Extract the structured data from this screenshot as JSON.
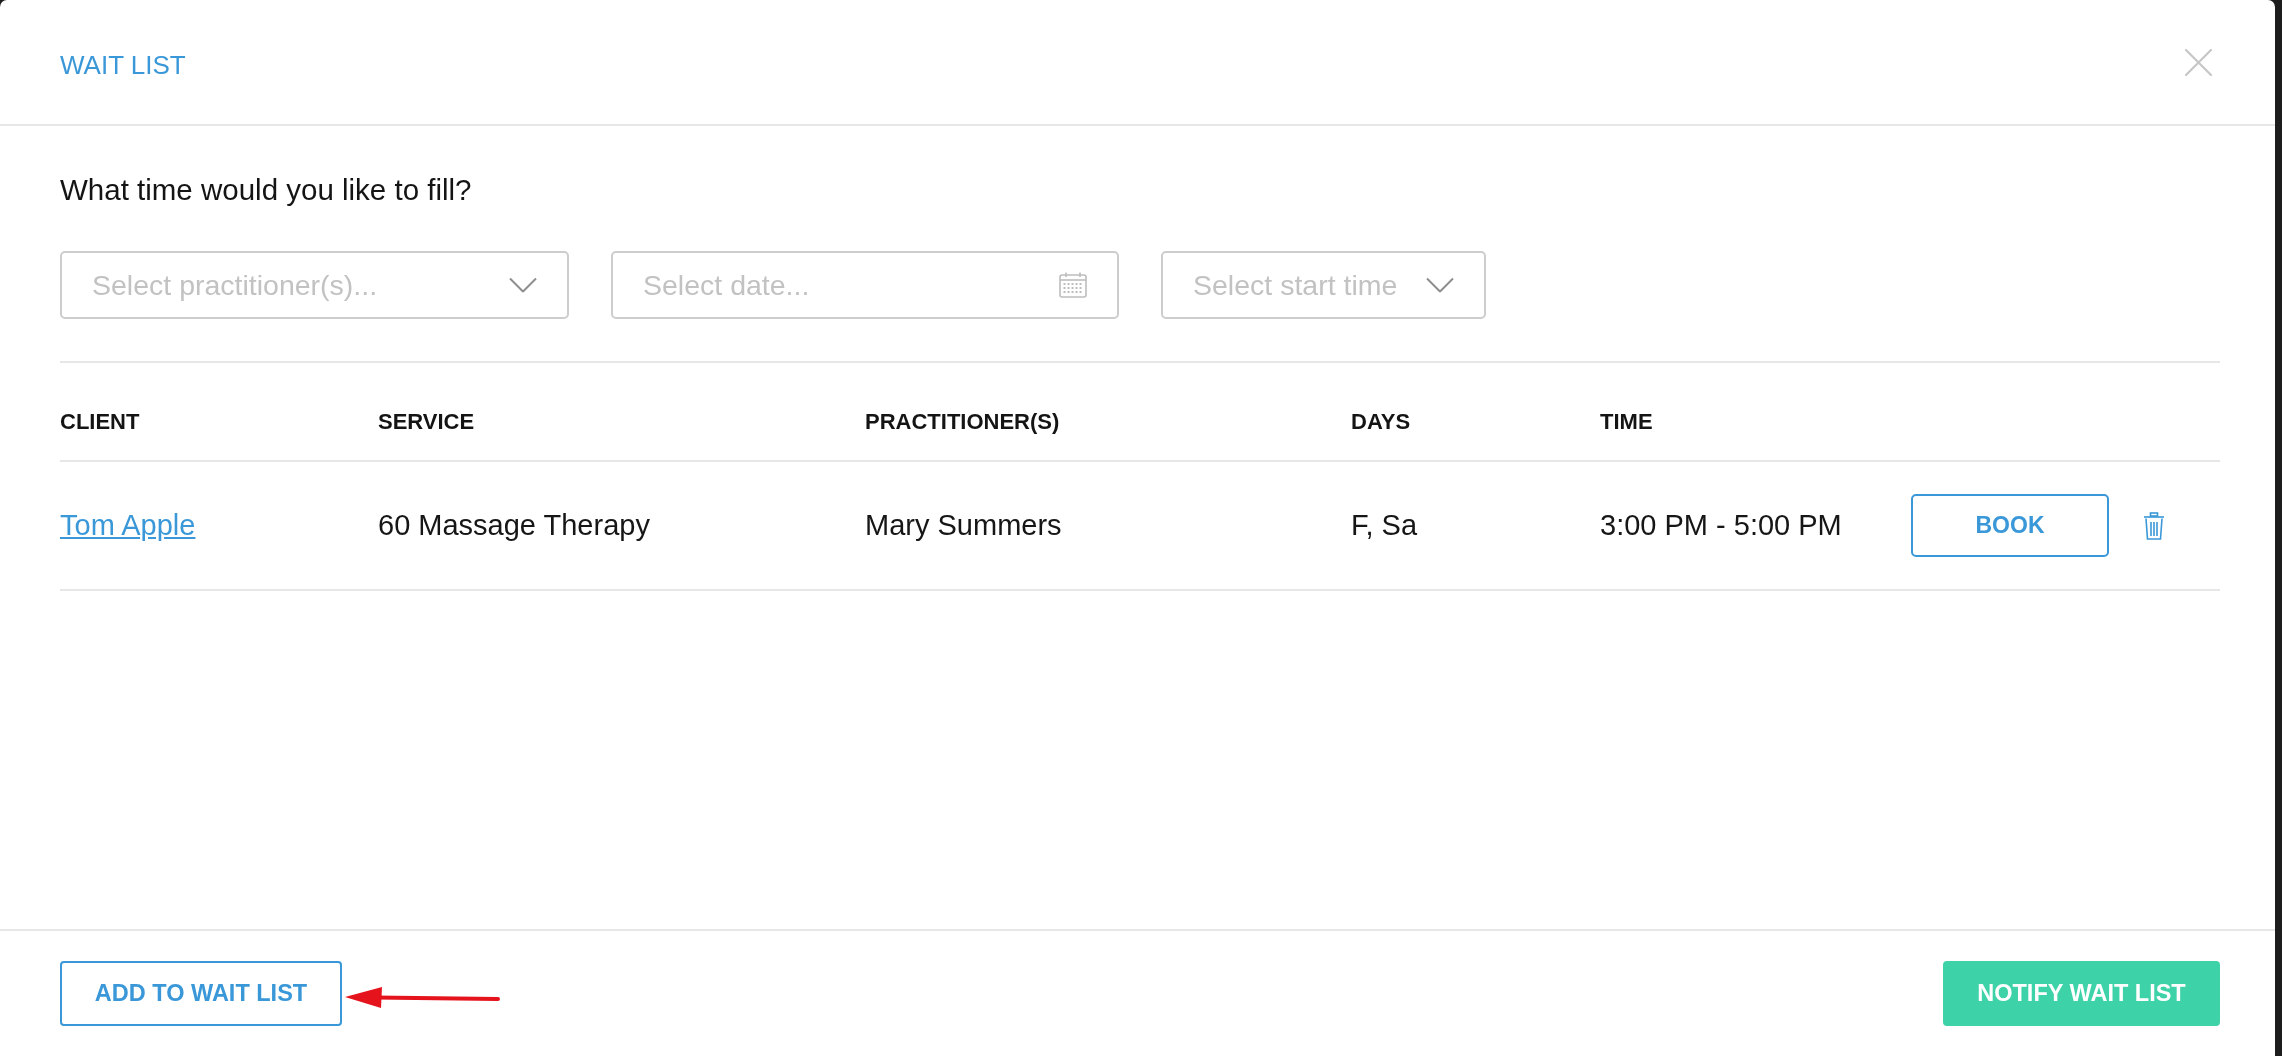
{
  "dialog": {
    "title": "WAIT LIST"
  },
  "prompt": "What time would you like to fill?",
  "filters": [
    {
      "kind": "dropdown",
      "placeholder": "Select practitioner(s)..."
    },
    {
      "kind": "date",
      "placeholder": "Select date..."
    },
    {
      "kind": "dropdown",
      "placeholder": "Select start time"
    }
  ],
  "table": {
    "columns": [
      "CLIENT",
      "SERVICE",
      "PRACTITIONER(S)",
      "DAYS",
      "TIME"
    ],
    "rows": [
      {
        "client": "Tom Apple",
        "service": "60 Massage Therapy",
        "practitioners": "Mary Summers",
        "days": "F, Sa",
        "time": "3:00 PM - 5:00 PM",
        "action": "BOOK"
      }
    ]
  },
  "footer": {
    "buttons": [
      {
        "kind": "outline",
        "label": "ADD TO WAIT LIST"
      },
      {
        "kind": "primary",
        "label": "NOTIFY WAIT LIST"
      }
    ]
  }
}
